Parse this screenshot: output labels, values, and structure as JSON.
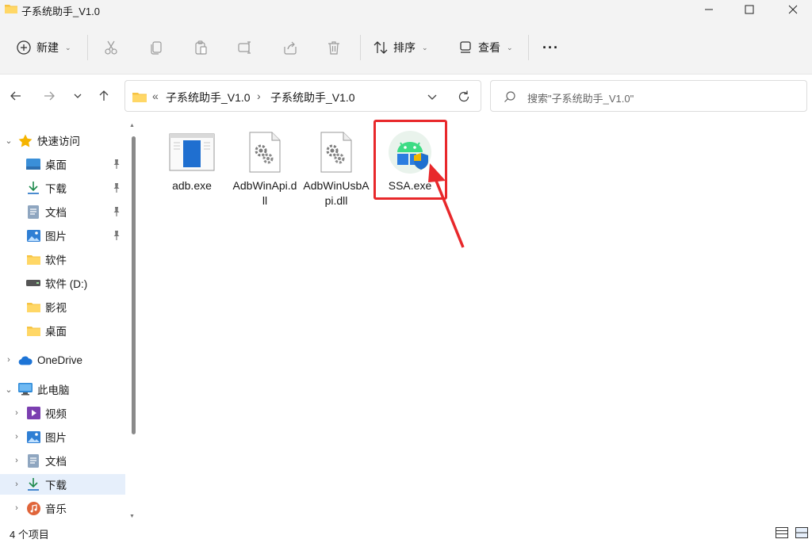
{
  "window": {
    "title": "子系统助手_V1.0"
  },
  "toolbar": {
    "new_label": "新建",
    "sort_label": "排序",
    "view_label": "查看",
    "more_label": "···"
  },
  "address": {
    "overflow": "«",
    "crumb1": "子系统助手_V1.0",
    "sep": "›",
    "crumb2": "子系统助手_V1.0",
    "search_placeholder": "搜索\"子系统助手_V1.0\""
  },
  "sidebar": {
    "quick_access": "快速访问",
    "quick_items": [
      "桌面",
      "下载",
      "文档",
      "图片",
      "软件",
      "软件 (D:)",
      "影视",
      "桌面"
    ],
    "onedrive": "OneDrive",
    "this_pc": "此电脑",
    "pc_items": [
      "视频",
      "图片",
      "文档",
      "下载",
      "音乐"
    ]
  },
  "files": [
    {
      "name": "adb.exe",
      "icon": "exe-window-icon"
    },
    {
      "name": "AdbWinApi.dll",
      "icon": "dll-gear-icon"
    },
    {
      "name": "AdbWinUsbApi.dll",
      "icon": "dll-gear-icon"
    },
    {
      "name": "SSA.exe",
      "icon": "android-shield-icon"
    }
  ],
  "status": {
    "count": "4 个项目"
  },
  "colors": {
    "highlight": "#e8282b",
    "selected_row": "#e6effb",
    "folder": "#f6c343"
  }
}
